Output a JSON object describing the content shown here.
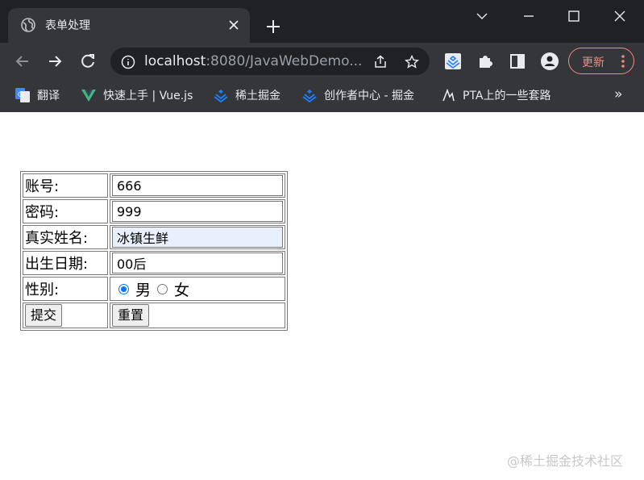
{
  "tab": {
    "title": "表单处理",
    "favicon": "globe-icon"
  },
  "toolbar": {
    "url_host": "localhost",
    "url_rest": ":8080/JavaWebDemo...",
    "update_label": "更新"
  },
  "bookmarks": [
    {
      "label": "翻译",
      "icon": "translate-icon"
    },
    {
      "label": "快速上手 | Vue.js",
      "icon": "vue-icon"
    },
    {
      "label": "稀土掘金",
      "icon": "juejin-icon"
    },
    {
      "label": "创作者中心 - 掘金",
      "icon": "juejin-icon"
    },
    {
      "label": "PTA上的一些套路",
      "icon": "pta-icon"
    }
  ],
  "form": {
    "account_label": "账号:",
    "account_value": "666",
    "password_label": "密码:",
    "password_value": "999",
    "realname_label": "真实姓名:",
    "realname_value": "冰镇生鲜",
    "birthday_label": "出生日期:",
    "birthday_value": "00后",
    "gender_label": "性别:",
    "gender_male": "男",
    "gender_female": "女",
    "submit_label": "提交",
    "reset_label": "重置"
  },
  "watermark": "@稀土掘金技术社区",
  "colors": {
    "chrome_dark": "#202124",
    "chrome_toolbar": "#35363a",
    "radio_accent": "#0075ff",
    "autofill": "#e8f0fe",
    "update_accent": "#f28b82"
  }
}
